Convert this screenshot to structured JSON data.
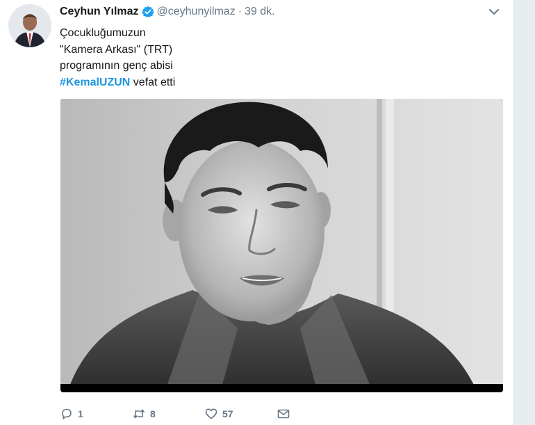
{
  "tweet": {
    "display_name": "Ceyhun Yılmaz",
    "handle": "@ceyhunyilmaz",
    "separator": "·",
    "timestamp": "39 dk.",
    "text_lines": [
      "Çocukluğumuzun",
      "\"Kamera Arkası\" (TRT)",
      "programının genç abisi"
    ],
    "hashtag": "#KemalUZUN",
    "hashtag_suffix": " vefat etti"
  },
  "actions": {
    "reply_count": "1",
    "retweet_count": "8",
    "like_count": "57"
  },
  "icons": {
    "verified": "verified-badge-icon",
    "caret": "chevron-down-icon",
    "reply": "reply-icon",
    "retweet": "retweet-icon",
    "like": "heart-icon",
    "dm": "envelope-icon"
  },
  "colors": {
    "link": "#1b95e0",
    "muted": "#657786",
    "verified": "#1da1f2"
  }
}
